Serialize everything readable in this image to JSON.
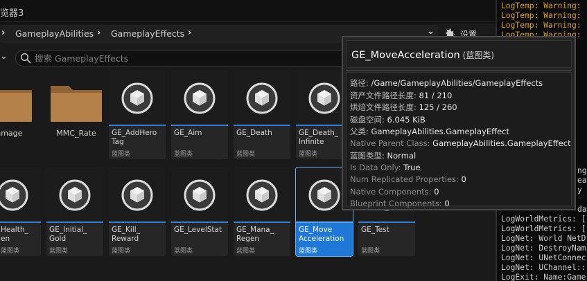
{
  "tab": {
    "title": "览器3"
  },
  "breadcrumbs": [
    "GameplayAbilities",
    "GameplayEffects"
  ],
  "settings": {
    "label": "设置"
  },
  "search": {
    "placeholder": "搜索 GameplayEffects"
  },
  "folders": [
    {
      "name": "Damage"
    },
    {
      "name": "MMC_Rate"
    }
  ],
  "row1_assets": [
    {
      "name": "GE_AddHero\nTag",
      "type": "蓝图类"
    },
    {
      "name": "GE_Aim",
      "type": "蓝图类"
    },
    {
      "name": "GE_Death",
      "type": "蓝图类"
    },
    {
      "name": "GE_Death_\nInfinite",
      "type": "蓝图类"
    }
  ],
  "row2_assets": [
    {
      "name": "Health_\nen",
      "type": "蓝图类"
    },
    {
      "name": "GE_Initial_\nGold",
      "type": "蓝图类"
    },
    {
      "name": "GE_Kill_\nReward",
      "type": "蓝图类"
    },
    {
      "name": "GE_LevelStat",
      "type": "蓝图类"
    },
    {
      "name": "GE_Mana_\nRegen",
      "type": "蓝图类"
    },
    {
      "name": "GE_Move\nAcceleration",
      "type": "蓝图类",
      "selected": true
    },
    {
      "name": "GE_Test",
      "type": "蓝图类"
    }
  ],
  "tooltip": {
    "name": "GE_MoveAcceleration",
    "class_label": "(蓝图类)",
    "rows": [
      {
        "key": "路径:",
        "value": "/Game/GameplayAbilities/GameplayEffects"
      },
      {
        "key": "资产文件路径长度:",
        "value": "81 / 210"
      },
      {
        "key": "烘焙文件路径长度:",
        "value": "125 / 260"
      },
      {
        "key": "磁盘空间:",
        "value": "6.045 KiB"
      },
      {
        "key": "父类:",
        "value": "GameplayAbilities.GameplayEffect"
      },
      {
        "key": "Native Parent Class:",
        "value": "GameplayAbilities.GameplayEffect"
      },
      {
        "key": "蓝图类型:",
        "value": "Normal"
      },
      {
        "key": "Is Data Only:",
        "value": "True"
      },
      {
        "key": "Num Replicated Properties:",
        "value": "0"
      },
      {
        "key": "Native Components:",
        "value": "0"
      },
      {
        "key": "Blueprint Components:",
        "value": "0"
      }
    ]
  },
  "log": {
    "warnings": [
      "LogTemp: Warning:",
      "LogTemp: Warning:",
      "LogTemp: Warning:",
      "LogTemp: Warning:"
    ],
    "partial_tail": [
      "ng",
      "ea",
      "y",
      "da"
    ],
    "lines": [
      "LogWorldMetrics: [",
      "LogWorldMetrics: [",
      "LogNet: World NetD",
      "LogNet: DestroyNam",
      "LogNet: UNetConnec",
      "LogNet: UChannel::",
      "LogExit: Name:Game"
    ]
  },
  "colors": {
    "accent": "#2f7fd9",
    "selected": "#1f78d6",
    "warning": "#d9a227",
    "folder": "#b5814a"
  }
}
